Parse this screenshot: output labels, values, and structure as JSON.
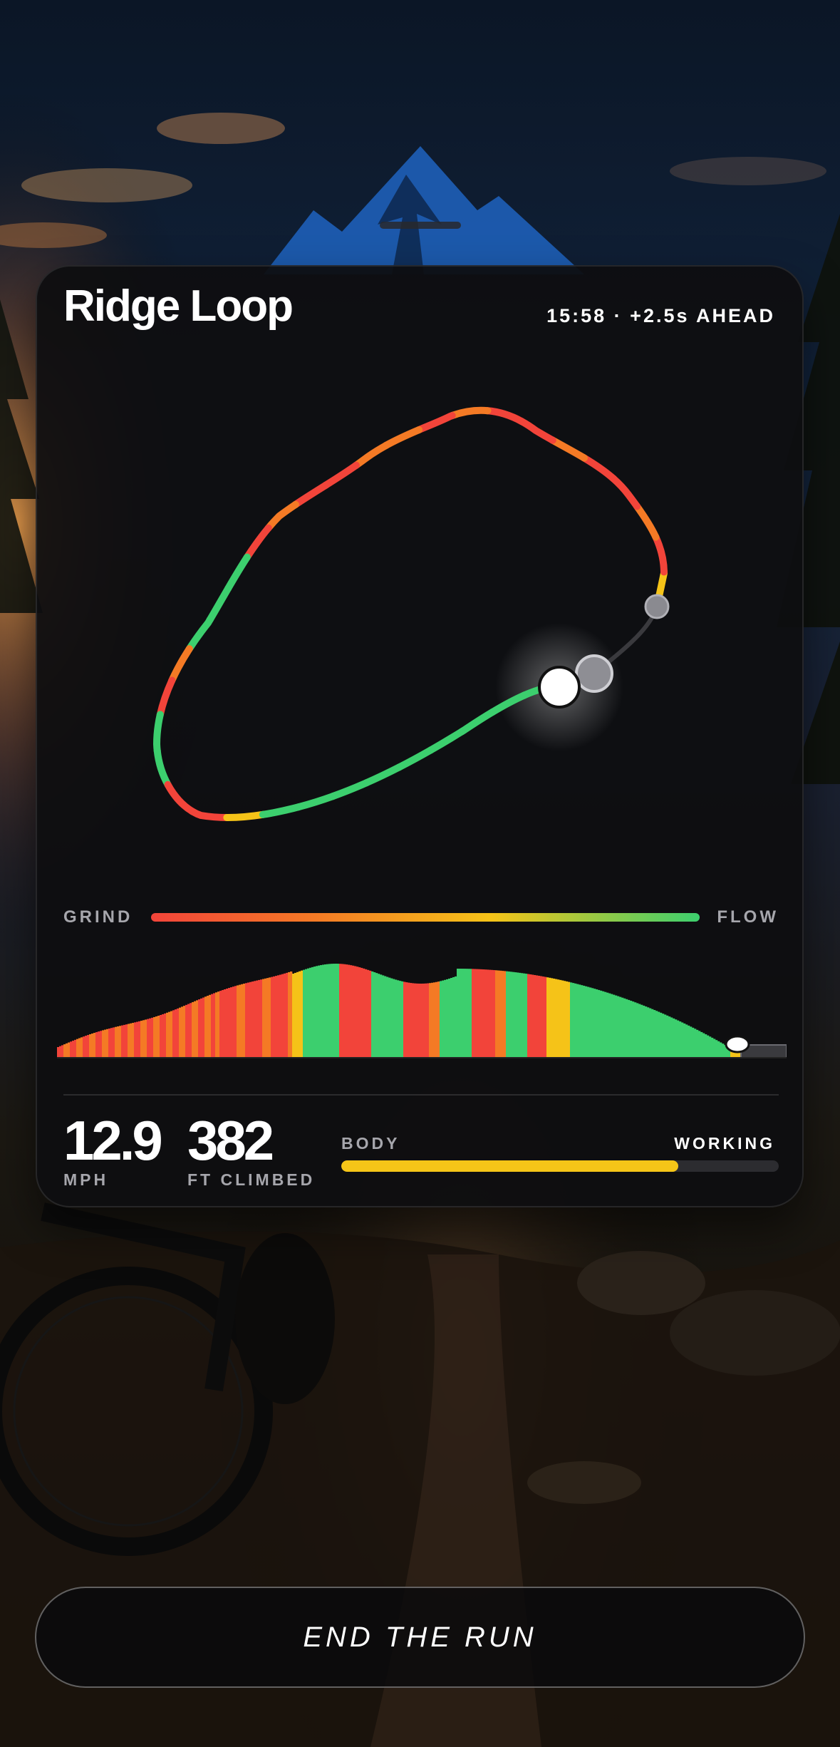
{
  "header": {
    "title": "Ridge Loop",
    "status": "15:58 · +2.5s AHEAD"
  },
  "scale": {
    "left_label": "GRIND",
    "right_label": "FLOW"
  },
  "stats": {
    "speed": {
      "value": "12.9",
      "unit": "MPH"
    },
    "climb": {
      "value": "382",
      "unit": "FT CLIMBED"
    }
  },
  "body": {
    "label": "BODY",
    "state": "WORKING",
    "level": 0.77
  },
  "actions": {
    "end_label": "END THE RUN"
  },
  "colors": {
    "grind": "#f2443a",
    "mid": "#f5c318",
    "flow": "#3ccf6e",
    "body_bar": "#f5c518"
  },
  "icons": {
    "logo": "mountain-logo",
    "rider": "current-position-marker",
    "ghost": "ghost-rider-marker"
  }
}
